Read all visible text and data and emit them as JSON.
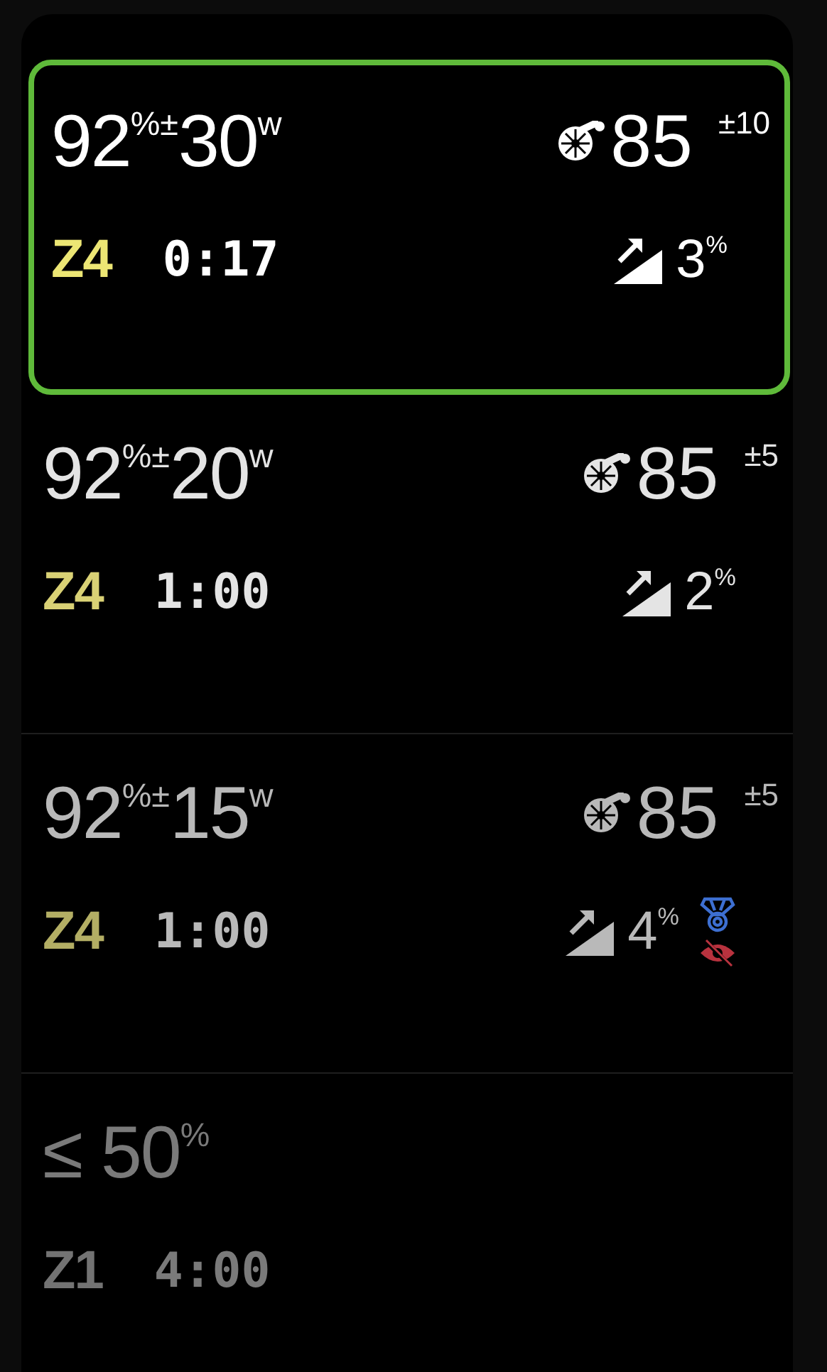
{
  "intervals": [
    {
      "selected": true,
      "color": "#ffffff",
      "power": "92$^{%}$$^{±}$30$^{w}$",
      "cadence": "85",
      "cadence_tolerance": "±10",
      "zone": {
        "label": "Z4",
        "color": "#ece674"
      },
      "duration": "0:17",
      "grade": "3$^{%}$"
    },
    {
      "selected": false,
      "color": "#e4e4e4",
      "power": "92$^{%}$$^{±}$20$^{w}$",
      "cadence": "85",
      "cadence_tolerance": "±5",
      "zone": {
        "label": "Z4",
        "color": "#d9d175"
      },
      "duration": "1:00",
      "grade": "2$^{%}$"
    },
    {
      "selected": false,
      "color": "#b9b9b9",
      "power": "92$^{%}$$^{±}$15$^{w}$",
      "cadence": "85",
      "cadence_tolerance": "±5",
      "zone": {
        "label": "Z4",
        "color": "#b3ae64"
      },
      "duration": "1:00",
      "grade": "4$^{%}$",
      "badges": [
        {
          "kind": "medal",
          "color": "#3d6fd1"
        },
        {
          "kind": "hidden",
          "color": "#b8323e"
        }
      ]
    },
    {
      "selected": false,
      "color": "#7a7a7a",
      "power": "≤ 50$^{%}$",
      "zone": {
        "label": "Z1",
        "color": "#737373"
      },
      "duration": "4:00"
    }
  ]
}
